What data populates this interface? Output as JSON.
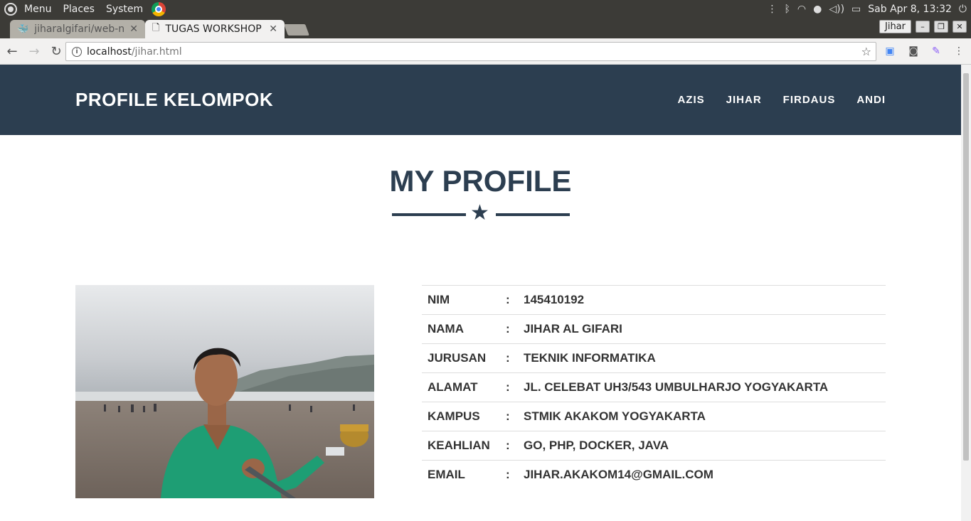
{
  "os_panel": {
    "menu": "Menu",
    "places": "Places",
    "system": "System",
    "clock": "Sab Apr  8, 13:32"
  },
  "browser": {
    "tabs": [
      {
        "title": "jiharalgifari/web-n",
        "active": false,
        "icon": "docker-icon"
      },
      {
        "title": "TUGAS WORKSHOP",
        "active": true,
        "icon": "page-icon"
      }
    ],
    "user": "Jihar",
    "url_host": "localhost",
    "url_path": "/jihar.html"
  },
  "site": {
    "brand": "PROFILE KELOMPOK",
    "nav": [
      "AZIS",
      "JIHAR",
      "FIRDAUS",
      "ANDI"
    ],
    "heading": "MY PROFILE",
    "profile": [
      {
        "label": "NIM",
        "colon": ":",
        "value": "145410192"
      },
      {
        "label": "NAMA",
        "colon": ":",
        "value": "JIHAR AL GIFARI"
      },
      {
        "label": "JURUSAN",
        "colon": ":",
        "value": "TEKNIK INFORMATIKA"
      },
      {
        "label": "ALAMAT",
        "colon": ":",
        "value": "JL. CELEBAT UH3/543 UMBULHARJO YOGYAKARTA"
      },
      {
        "label": "KAMPUS",
        "colon": ":",
        "value": "STMIK AKAKOM YOGYAKARTA"
      },
      {
        "label": "KEAHLIAN",
        "colon": ":",
        "value": "GO, PHP, DOCKER, JAVA"
      },
      {
        "label": "EMAIL",
        "colon": ":",
        "value": "JIHAR.AKAKOM14@GMAIL.COM"
      }
    ]
  },
  "colors": {
    "navbar": "#2c3e50",
    "heading": "#2c3e50",
    "os_panel": "#3c3b37"
  }
}
